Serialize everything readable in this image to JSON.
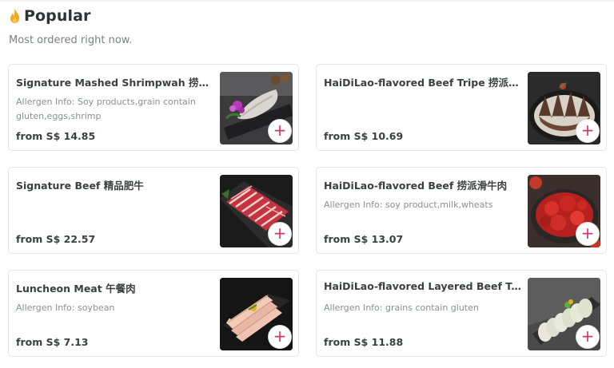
{
  "section": {
    "title": "Popular",
    "subtitle": "Most ordered right now.",
    "title_icon": "flame-icon"
  },
  "colors": {
    "accent": "#d6336c",
    "flame": "#f5a623",
    "text": "#2e3333",
    "muted": "#8a8f8f",
    "border": "#e4e6e6"
  },
  "items": [
    {
      "name": "Signature Mashed Shrimpwah 捞派虾滑",
      "allergen": "Allergen Info: Soy products,grain contain gluten,eggs,shrimp",
      "price": "from S$ 14.85",
      "image": "shrimp-paste-dish"
    },
    {
      "name": "HaiDiLao-flavored Beef Tripe 捞派鲜毛...",
      "allergen": "",
      "price": "from S$ 10.69",
      "image": "beef-tripe-dish"
    },
    {
      "name": "Signature Beef 精品肥牛",
      "allergen": "",
      "price": "from S$ 22.57",
      "image": "sliced-beef-dish"
    },
    {
      "name": "HaiDiLao-flavored Beef 捞派滑牛肉",
      "allergen": "Allergen Info: soy product,milk,wheats",
      "price": "from S$ 13.07",
      "image": "marinated-beef-dish"
    },
    {
      "name": "Luncheon Meat 午餐肉",
      "allergen": "Allergen Info: soybean",
      "price": "from S$ 7.13",
      "image": "luncheon-meat-dish"
    },
    {
      "name": "HaiDiLao-flavored Layered Beef Tripe...",
      "allergen": "Allergen Info: grains contain gluten",
      "price": "from S$ 11.88",
      "image": "layered-tripe-dish"
    }
  ]
}
